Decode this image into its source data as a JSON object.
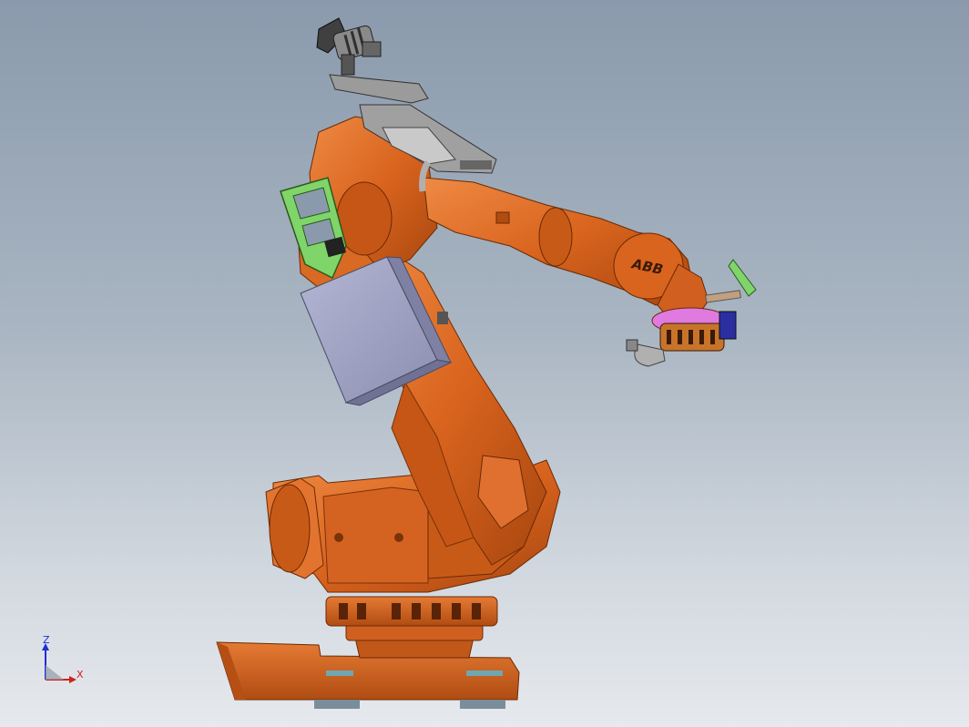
{
  "viewport": {
    "background_top": "#8a9aac",
    "background_bottom": "#e6e9ed"
  },
  "model": {
    "brand_label": "ABB",
    "body_color": "#d9641e",
    "shade_color": "#a8460f",
    "highlight_color": "#ee8a44",
    "bracket_color": "#7fd46a",
    "box_color": "#a5a8c8",
    "tool_color": "#9a9a9a"
  },
  "triad": {
    "z_label": "Z",
    "x_label": "X",
    "z_color": "#1f2fd0",
    "x_color": "#d02020"
  }
}
